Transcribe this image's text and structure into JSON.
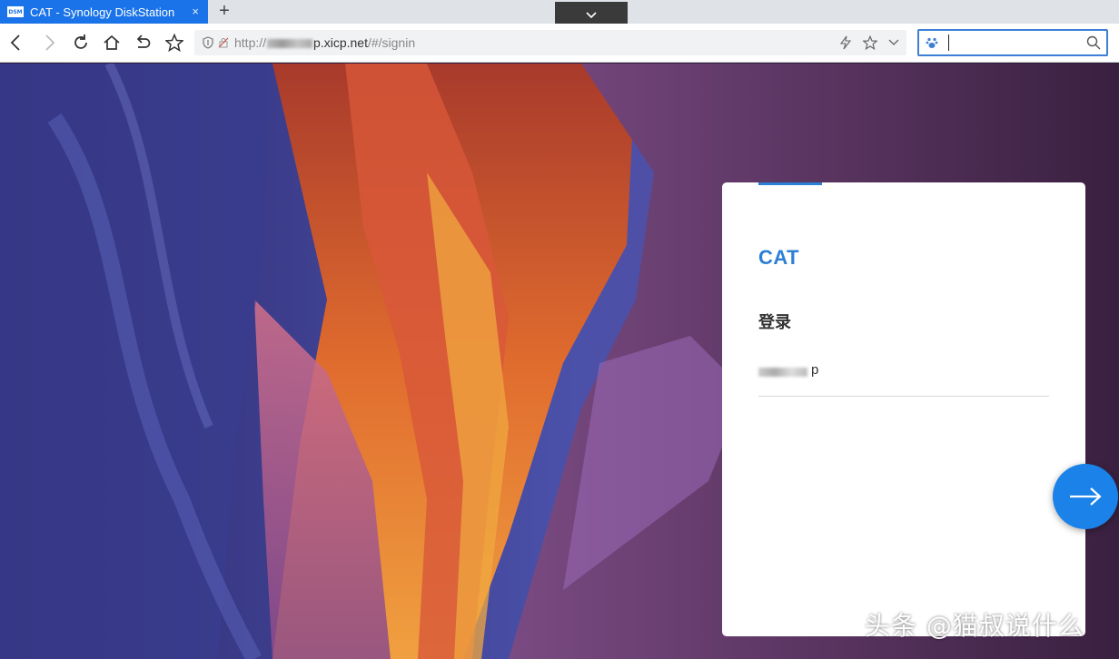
{
  "browser": {
    "tab": {
      "favicon_text": "DSM",
      "title": "CAT - Synology DiskStation",
      "close_glyph": "×"
    },
    "new_tab_glyph": "+",
    "address_bar": {
      "scheme": "http://",
      "host_suffix": "p.xicp.net",
      "path": "/#/signin"
    },
    "search_box": {
      "value": ""
    }
  },
  "login": {
    "title": "CAT",
    "subtitle": "登录",
    "username_suffix": "p"
  },
  "watermark": "头条 @猫叔说什么",
  "colors": {
    "accent": "#2b7fd4",
    "tab": "#1a73e8",
    "next_button": "#1a82e8"
  }
}
